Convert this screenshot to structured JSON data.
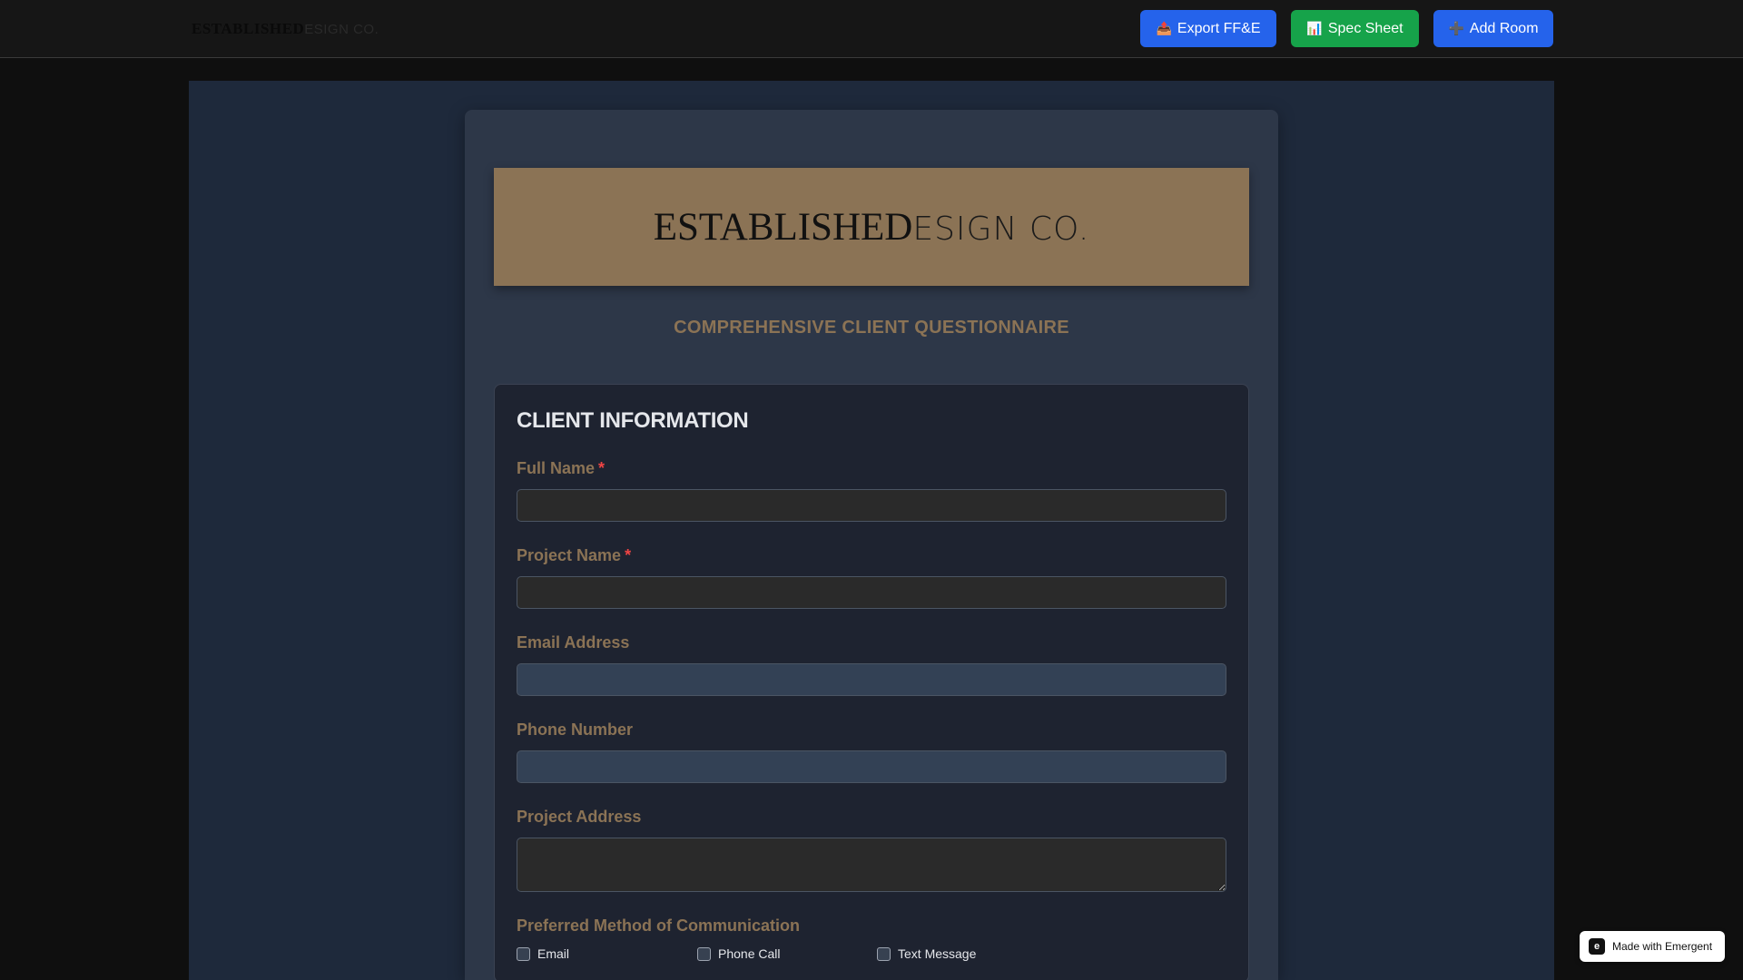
{
  "header": {
    "brand_bold": "ESTABLISHED",
    "brand_light": "ESIGN CO.",
    "buttons": {
      "export": {
        "icon": "📤",
        "label": "Export FF&E"
      },
      "spec": {
        "icon": "📊",
        "label": "Spec Sheet"
      },
      "add": {
        "icon": "➕",
        "label": "Add Room"
      }
    }
  },
  "banner": {
    "logo_bold": "ESTABLISHED",
    "logo_light": "ESIGN CO."
  },
  "subtitle": "COMPREHENSIVE CLIENT QUESTIONNAIRE",
  "section": {
    "title": "CLIENT INFORMATION",
    "required_mark": "*",
    "fields": {
      "full_name": {
        "label": "Full Name",
        "value": "",
        "placeholder": ""
      },
      "project_name": {
        "label": "Project Name",
        "value": "",
        "placeholder": ""
      },
      "email": {
        "label": "Email Address",
        "value": "",
        "placeholder": ""
      },
      "phone": {
        "label": "Phone Number",
        "value": "",
        "placeholder": ""
      },
      "address": {
        "label": "Project Address",
        "value": "",
        "placeholder": ""
      }
    },
    "communication": {
      "label": "Preferred Method of Communication",
      "options": [
        "Email",
        "Phone Call",
        "Text Message"
      ]
    }
  },
  "badge": {
    "logo": "e",
    "text": "Made with Emergent"
  },
  "colors": {
    "accent": "#8b7355",
    "primary_button": "#2563eb",
    "success_button": "#16a34a",
    "required": "#ef4444"
  }
}
